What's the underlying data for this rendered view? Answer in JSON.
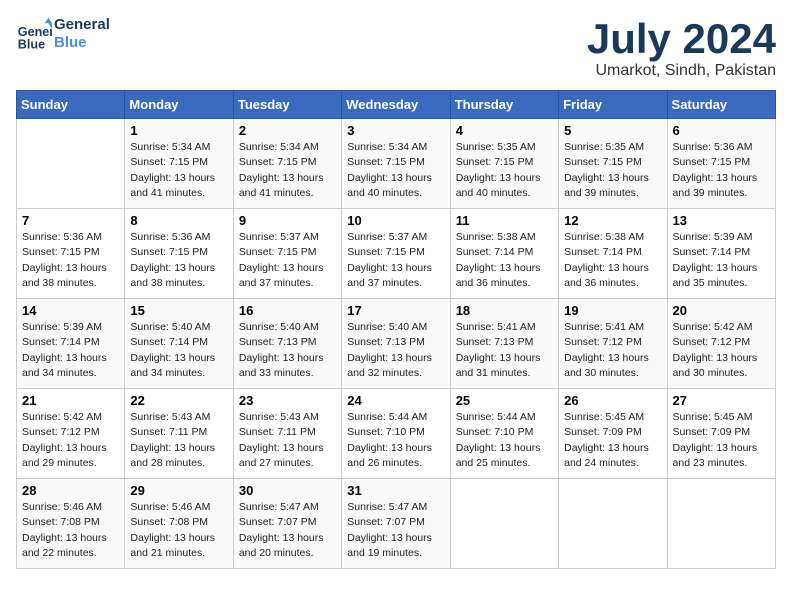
{
  "header": {
    "logo_line1": "General",
    "logo_line2": "Blue",
    "month": "July 2024",
    "location": "Umarkot, Sindh, Pakistan"
  },
  "days_of_week": [
    "Sunday",
    "Monday",
    "Tuesday",
    "Wednesday",
    "Thursday",
    "Friday",
    "Saturday"
  ],
  "weeks": [
    [
      {
        "day": "",
        "info": ""
      },
      {
        "day": "1",
        "info": "Sunrise: 5:34 AM\nSunset: 7:15 PM\nDaylight: 13 hours\nand 41 minutes."
      },
      {
        "day": "2",
        "info": "Sunrise: 5:34 AM\nSunset: 7:15 PM\nDaylight: 13 hours\nand 41 minutes."
      },
      {
        "day": "3",
        "info": "Sunrise: 5:34 AM\nSunset: 7:15 PM\nDaylight: 13 hours\nand 40 minutes."
      },
      {
        "day": "4",
        "info": "Sunrise: 5:35 AM\nSunset: 7:15 PM\nDaylight: 13 hours\nand 40 minutes."
      },
      {
        "day": "5",
        "info": "Sunrise: 5:35 AM\nSunset: 7:15 PM\nDaylight: 13 hours\nand 39 minutes."
      },
      {
        "day": "6",
        "info": "Sunrise: 5:36 AM\nSunset: 7:15 PM\nDaylight: 13 hours\nand 39 minutes."
      }
    ],
    [
      {
        "day": "7",
        "info": "Sunrise: 5:36 AM\nSunset: 7:15 PM\nDaylight: 13 hours\nand 38 minutes."
      },
      {
        "day": "8",
        "info": "Sunrise: 5:36 AM\nSunset: 7:15 PM\nDaylight: 13 hours\nand 38 minutes."
      },
      {
        "day": "9",
        "info": "Sunrise: 5:37 AM\nSunset: 7:15 PM\nDaylight: 13 hours\nand 37 minutes."
      },
      {
        "day": "10",
        "info": "Sunrise: 5:37 AM\nSunset: 7:15 PM\nDaylight: 13 hours\nand 37 minutes."
      },
      {
        "day": "11",
        "info": "Sunrise: 5:38 AM\nSunset: 7:14 PM\nDaylight: 13 hours\nand 36 minutes."
      },
      {
        "day": "12",
        "info": "Sunrise: 5:38 AM\nSunset: 7:14 PM\nDaylight: 13 hours\nand 36 minutes."
      },
      {
        "day": "13",
        "info": "Sunrise: 5:39 AM\nSunset: 7:14 PM\nDaylight: 13 hours\nand 35 minutes."
      }
    ],
    [
      {
        "day": "14",
        "info": "Sunrise: 5:39 AM\nSunset: 7:14 PM\nDaylight: 13 hours\nand 34 minutes."
      },
      {
        "day": "15",
        "info": "Sunrise: 5:40 AM\nSunset: 7:14 PM\nDaylight: 13 hours\nand 34 minutes."
      },
      {
        "day": "16",
        "info": "Sunrise: 5:40 AM\nSunset: 7:13 PM\nDaylight: 13 hours\nand 33 minutes."
      },
      {
        "day": "17",
        "info": "Sunrise: 5:40 AM\nSunset: 7:13 PM\nDaylight: 13 hours\nand 32 minutes."
      },
      {
        "day": "18",
        "info": "Sunrise: 5:41 AM\nSunset: 7:13 PM\nDaylight: 13 hours\nand 31 minutes."
      },
      {
        "day": "19",
        "info": "Sunrise: 5:41 AM\nSunset: 7:12 PM\nDaylight: 13 hours\nand 30 minutes."
      },
      {
        "day": "20",
        "info": "Sunrise: 5:42 AM\nSunset: 7:12 PM\nDaylight: 13 hours\nand 30 minutes."
      }
    ],
    [
      {
        "day": "21",
        "info": "Sunrise: 5:42 AM\nSunset: 7:12 PM\nDaylight: 13 hours\nand 29 minutes."
      },
      {
        "day": "22",
        "info": "Sunrise: 5:43 AM\nSunset: 7:11 PM\nDaylight: 13 hours\nand 28 minutes."
      },
      {
        "day": "23",
        "info": "Sunrise: 5:43 AM\nSunset: 7:11 PM\nDaylight: 13 hours\nand 27 minutes."
      },
      {
        "day": "24",
        "info": "Sunrise: 5:44 AM\nSunset: 7:10 PM\nDaylight: 13 hours\nand 26 minutes."
      },
      {
        "day": "25",
        "info": "Sunrise: 5:44 AM\nSunset: 7:10 PM\nDaylight: 13 hours\nand 25 minutes."
      },
      {
        "day": "26",
        "info": "Sunrise: 5:45 AM\nSunset: 7:09 PM\nDaylight: 13 hours\nand 24 minutes."
      },
      {
        "day": "27",
        "info": "Sunrise: 5:45 AM\nSunset: 7:09 PM\nDaylight: 13 hours\nand 23 minutes."
      }
    ],
    [
      {
        "day": "28",
        "info": "Sunrise: 5:46 AM\nSunset: 7:08 PM\nDaylight: 13 hours\nand 22 minutes."
      },
      {
        "day": "29",
        "info": "Sunrise: 5:46 AM\nSunset: 7:08 PM\nDaylight: 13 hours\nand 21 minutes."
      },
      {
        "day": "30",
        "info": "Sunrise: 5:47 AM\nSunset: 7:07 PM\nDaylight: 13 hours\nand 20 minutes."
      },
      {
        "day": "31",
        "info": "Sunrise: 5:47 AM\nSunset: 7:07 PM\nDaylight: 13 hours\nand 19 minutes."
      },
      {
        "day": "",
        "info": ""
      },
      {
        "day": "",
        "info": ""
      },
      {
        "day": "",
        "info": ""
      }
    ]
  ]
}
